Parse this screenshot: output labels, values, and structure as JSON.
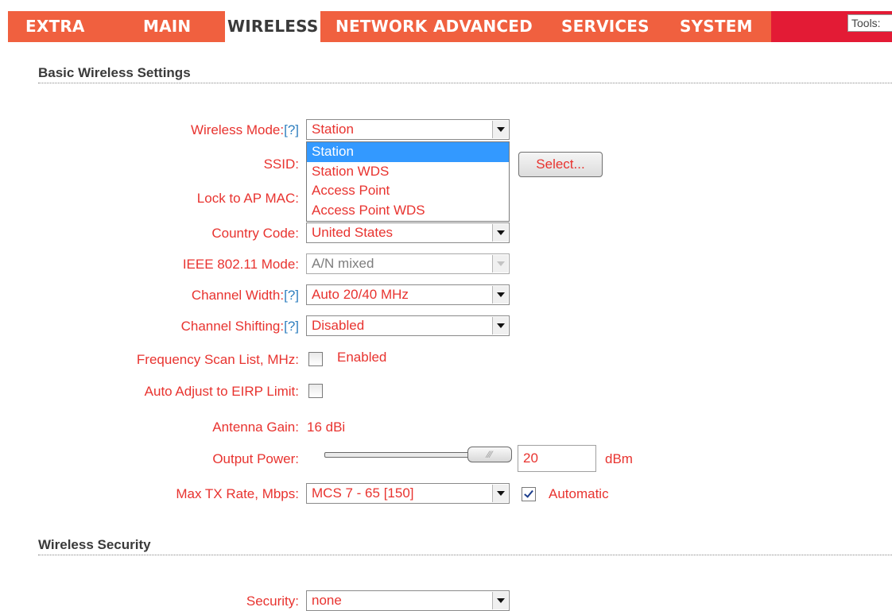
{
  "nav": {
    "tabs": [
      {
        "label": "EXTRA"
      },
      {
        "label": "MAIN"
      },
      {
        "label": "WIRELESS"
      },
      {
        "label": "NETWORK"
      },
      {
        "label": "ADVANCED"
      },
      {
        "label": "SERVICES"
      },
      {
        "label": "SYSTEM"
      }
    ],
    "active_tab": "WIRELESS",
    "tools_label": "Tools:"
  },
  "basic": {
    "title": "Basic Wireless Settings",
    "wireless_mode": {
      "label": "Wireless Mode:",
      "help": "[?]",
      "value": "Station",
      "options": [
        "Station",
        "Station WDS",
        "Access Point",
        "Access Point WDS"
      ]
    },
    "ssid": {
      "label": "SSID:",
      "button": "Select..."
    },
    "lock_ap_mac": {
      "label": "Lock to AP MAC:"
    },
    "country_code": {
      "label": "Country Code:",
      "value": "United States"
    },
    "ieee_mode": {
      "label": "IEEE 802.11 Mode:",
      "value": "A/N mixed"
    },
    "channel_width": {
      "label": "Channel Width:",
      "help": "[?]",
      "value": "Auto 20/40 MHz"
    },
    "channel_shifting": {
      "label": "Channel Shifting:",
      "help": "[?]",
      "value": "Disabled"
    },
    "freq_scan": {
      "label": "Frequency Scan List, MHz:",
      "checkbox_label": "Enabled",
      "checked": false
    },
    "auto_adjust": {
      "label": "Auto Adjust to EIRP Limit:",
      "checked": false
    },
    "antenna_gain": {
      "label": "Antenna Gain:",
      "value": "16 dBi"
    },
    "output_power": {
      "label": "Output Power:",
      "value": "20",
      "unit": "dBm",
      "slider_fraction": 1.0
    },
    "max_tx_rate": {
      "label": "Max TX Rate, Mbps:",
      "value": "MCS 7 - 65 [150]",
      "auto_label": "Automatic",
      "auto_checked": true
    }
  },
  "security": {
    "title": "Wireless Security",
    "security_field": {
      "label": "Security:",
      "value": "none"
    }
  },
  "colors": {
    "nav_orange": "#f0603f",
    "nav_red": "#e31b35",
    "label_red": "#e8332f",
    "help_blue": "#2f7fbf",
    "selected_blue": "#3399ff"
  }
}
